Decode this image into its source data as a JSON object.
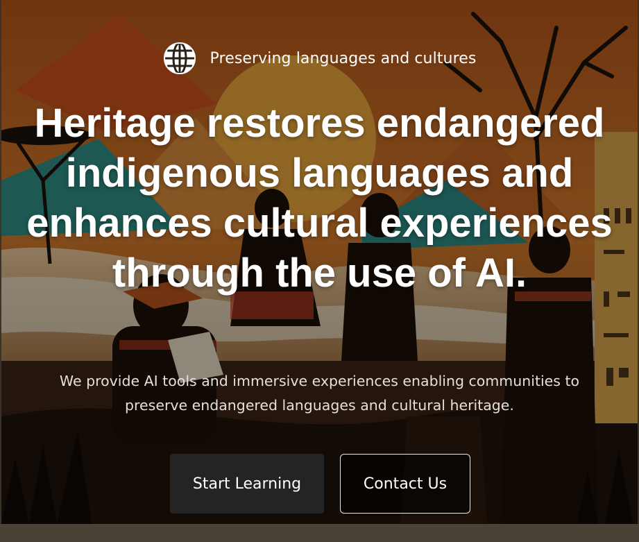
{
  "hero": {
    "tagline": "Preserving languages and cultures",
    "tagline_icon": "globe-icon",
    "headline": "Heritage restores endangered indigenous languages and enhances cultural experiences through the use of AI.",
    "subtext": "We provide AI tools and immersive experiences enabling communities to preserve endangered languages and cultural heritage."
  },
  "buttons": {
    "primary_label": "Start Learning",
    "secondary_label": "Contact Us"
  },
  "colors": {
    "text": "#ffffff",
    "primary_button_bg": "#242424",
    "secondary_button_border": "#e8e8e8",
    "background_warm": "#d06a1e"
  }
}
